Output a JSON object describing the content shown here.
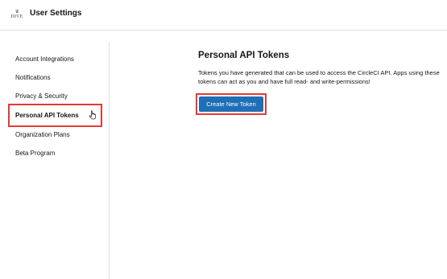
{
  "header": {
    "logo_text": "DIVE",
    "title": "User Settings"
  },
  "sidebar": {
    "items": [
      {
        "label": "Account Integrations",
        "active": false
      },
      {
        "label": "Notifications",
        "active": false
      },
      {
        "label": "Privacy & Security",
        "active": false
      },
      {
        "label": "Personal API Tokens",
        "active": true
      },
      {
        "label": "Organization Plans",
        "active": false
      },
      {
        "label": "Beta Program",
        "active": false
      }
    ]
  },
  "main": {
    "title": "Personal API Tokens",
    "description": "Tokens you have generated that can be used to access the CircleCI API. Apps using these tokens can act as you and have full read- and write-permissions!",
    "create_button_label": "Create New Token"
  },
  "colors": {
    "accent": "#1f6fb6",
    "highlight": "#e53935",
    "divider": "#e2e2e2"
  },
  "icons": {
    "logo": "brand-logo-icon",
    "cursor": "hand-pointer-icon"
  }
}
